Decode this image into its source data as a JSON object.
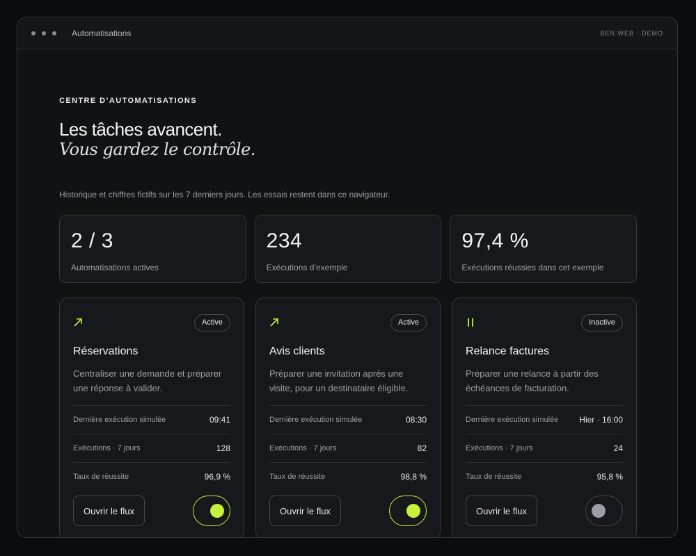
{
  "window": {
    "title": "Automatisations",
    "brand": "BEN WEB · DÉMO"
  },
  "hero": {
    "eyebrow": "CENTRE D’AUTOMATISATIONS",
    "headline": "Les tâches avancent.",
    "headline_italic": "Vous gardez le contrôle.",
    "subtitle": "Historique et chiffres fictifs sur les 7 derniers jours. Les essais restent dans ce navigateur."
  },
  "stats": [
    {
      "value": "2 / 3",
      "label": "Automatisations actives"
    },
    {
      "value": "234",
      "label": "Exécutions d’exemple"
    },
    {
      "value": "97,4 %",
      "label": "Exécutions réussies dans cet exemple"
    }
  ],
  "cards": [
    {
      "icon": "arrow-up-right-icon",
      "status": "Active",
      "title": "Réservations",
      "description": "Centraliser une demande et préparer une réponse à valider.",
      "rows": [
        {
          "label": "Dernière exécution simulée",
          "value": "09:41"
        },
        {
          "label": "Exécutions · 7 jours",
          "value": "128"
        },
        {
          "label": "Taux de réussite",
          "value": "96,9 %"
        }
      ],
      "button": "Ouvrir le flux",
      "enabled": true
    },
    {
      "icon": "arrow-up-right-icon",
      "status": "Active",
      "title": "Avis clients",
      "description": "Préparer une invitation après une visite, pour un destinataire éligible.",
      "rows": [
        {
          "label": "Dernière exécution simulée",
          "value": "08:30"
        },
        {
          "label": "Exécutions · 7 jours",
          "value": "82"
        },
        {
          "label": "Taux de réussite",
          "value": "98,8 %"
        }
      ],
      "button": "Ouvrir le flux",
      "enabled": true
    },
    {
      "icon": "pause-icon",
      "status": "Inactive",
      "title": "Relance factures",
      "description": "Préparer une relance à partir des échéances de facturation.",
      "rows": [
        {
          "label": "Dernière exécution simulée",
          "value": "Hier · 16:00"
        },
        {
          "label": "Exécutions · 7 jours",
          "value": "24"
        },
        {
          "label": "Taux de réussite",
          "value": "95,8 %"
        }
      ],
      "button": "Ouvrir le flux",
      "enabled": false
    }
  ],
  "colors": {
    "accent": "#c6f23c",
    "background": "#0b0c0e",
    "panel": "#17181b"
  }
}
